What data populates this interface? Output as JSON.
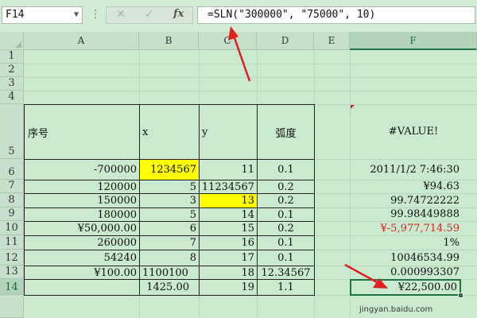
{
  "formula_bar": {
    "name_box": "F14",
    "kebab": "⋮",
    "cancel_icon": "✕",
    "enter_icon": "✓",
    "fx_label": "fx",
    "formula": "=SLN(\"300000\", \"75000\", 10)"
  },
  "columns": [
    "A",
    "B",
    "C",
    "D",
    "E",
    "F"
  ],
  "rows": [
    "1",
    "2",
    "3",
    "4",
    "5",
    "6",
    "7",
    "8",
    "9",
    "10",
    "11",
    "12",
    "13",
    "14"
  ],
  "headers": {
    "a": "序号",
    "b": "x",
    "c": "y",
    "d": "弧度",
    "f": "#VALUE!"
  },
  "table": [
    {
      "a": "-700000",
      "b": "1234567",
      "c": "11",
      "d": "0.1",
      "f": "2011/1/2 7:46:30"
    },
    {
      "a": "120000",
      "b": "5",
      "c": "11234567",
      "d": "0.2",
      "f": "¥94.63"
    },
    {
      "a": "150000",
      "b": "3",
      "c": "13",
      "d": "0.2",
      "f": "99.74722222"
    },
    {
      "a": "180000",
      "b": "5",
      "c": "14",
      "d": "0.1",
      "f": "99.98449888"
    },
    {
      "a": "¥50,000.00",
      "b": "6",
      "c": "15",
      "d": "0.2",
      "f": "¥-5,977,714.59"
    },
    {
      "a": "260000",
      "b": "7",
      "c": "16",
      "d": "0.1",
      "f": "1%"
    },
    {
      "a": "54240",
      "b": "8",
      "c": "17",
      "d": "0.1",
      "f": "10046534.99"
    },
    {
      "a": "¥100.00",
      "b": "1100100",
      "c": "18",
      "d": "12.34567",
      "f": "0.000993307"
    },
    {
      "a": "",
      "b": "1425.00",
      "c": "19",
      "d": "1.1",
      "f": "¥22,500.00"
    }
  ],
  "watermark": "jingyan.baidu.com",
  "colors": {
    "accent": "#217346",
    "highlight": "#ffff00",
    "negative": "#e02020",
    "arrow": "#e02020"
  }
}
